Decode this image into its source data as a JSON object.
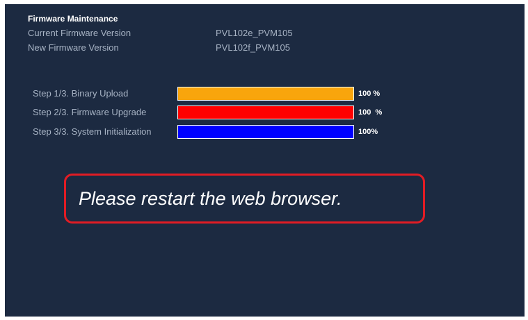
{
  "title": "Firmware Maintenance",
  "info": {
    "current_label": "Current Firmware Version",
    "current_value": "PVL102e_PVM105",
    "new_label": "New Firmware Version",
    "new_value": "PVL102f_PVM105"
  },
  "steps": [
    {
      "label": "Step 1/3. Binary Upload",
      "percent_text": "100 %",
      "progress": 1.0,
      "color": "#f9a50c"
    },
    {
      "label": "Step 2/3. Firmware Upgrade",
      "percent_text": "100  %",
      "progress": 1.0,
      "color": "#ff0000"
    },
    {
      "label": "Step 3/3. System Initialization",
      "percent_text": "100%",
      "progress": 1.0,
      "color": "#0000ff"
    }
  ],
  "message": "Please restart the web browser.",
  "colors": {
    "background": "#1c2a41",
    "message_border": "#e21c24",
    "text_muted": "#a7b3c4"
  }
}
